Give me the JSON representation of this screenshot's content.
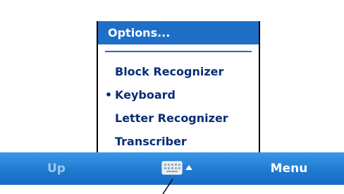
{
  "input_menu": {
    "header": "Options...",
    "items": [
      {
        "label": "Block Recognizer",
        "selected": false
      },
      {
        "label": "Keyboard",
        "selected": true
      },
      {
        "label": "Letter Recognizer",
        "selected": false
      },
      {
        "label": "Transcriber",
        "selected": false
      }
    ],
    "selected_marker": "•"
  },
  "taskbar": {
    "left_softkey": "Up",
    "right_softkey": "Menu",
    "sip_icon": "keyboard-icon",
    "sip_arrow_icon": "arrow-up-icon"
  },
  "colors": {
    "menu_highlight": "#1f6fc7",
    "menu_text": "#0a2d75",
    "taskbar": "#1f79cf",
    "softkey_disabled": "#9cc7ee"
  }
}
